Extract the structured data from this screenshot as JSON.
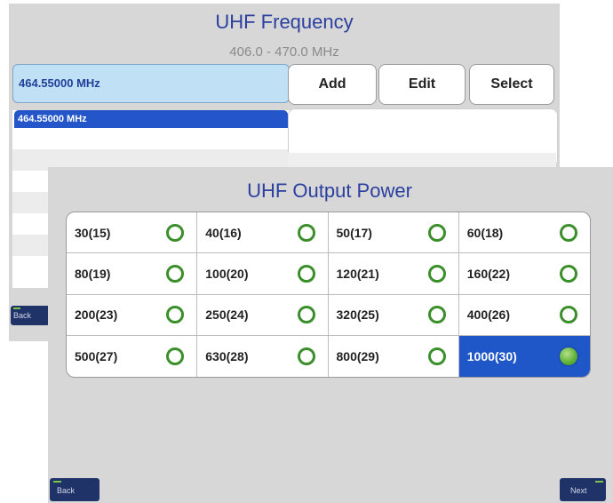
{
  "frequency_screen": {
    "title": "UHF Frequency",
    "range": "406.0 - 470.0 MHz",
    "input_value": "464.55000 MHz",
    "buttons": {
      "add": "Add",
      "edit": "Edit",
      "select": "Select"
    },
    "list": [
      "464.55000 MHz"
    ],
    "back_label": "Back"
  },
  "power_screen": {
    "title": "UHF Output Power",
    "options": [
      {
        "label": "30(15)"
      },
      {
        "label": "40(16)"
      },
      {
        "label": "50(17)"
      },
      {
        "label": "60(18)"
      },
      {
        "label": "80(19)"
      },
      {
        "label": "100(20)"
      },
      {
        "label": "120(21)"
      },
      {
        "label": "160(22)"
      },
      {
        "label": "200(23)"
      },
      {
        "label": "250(24)"
      },
      {
        "label": "320(25)"
      },
      {
        "label": "400(26)"
      },
      {
        "label": "500(27)"
      },
      {
        "label": "630(28)"
      },
      {
        "label": "800(29)"
      },
      {
        "label": "1000(30)"
      }
    ],
    "selected_option": "1000(30)",
    "back_label": "Back",
    "next_label": "Next"
  },
  "colors": {
    "accent": "#2b3f9e",
    "selection": "#1f56c8",
    "radio": "#3a8f2a",
    "nav_button": "#1f3368"
  }
}
